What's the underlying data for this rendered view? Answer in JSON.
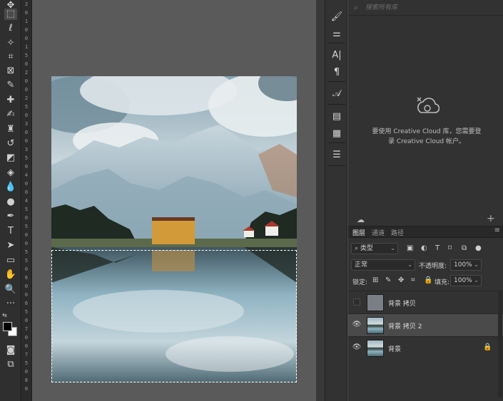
{
  "toolbar": {
    "tools": [
      {
        "name": "move-tool",
        "glyph": "✥"
      },
      {
        "name": "marquee-tool",
        "glyph": "⬚"
      },
      {
        "name": "lasso-tool",
        "glyph": "ℓ"
      },
      {
        "name": "magic-wand-tool",
        "glyph": "✧"
      },
      {
        "name": "crop-tool",
        "glyph": "⌗"
      },
      {
        "name": "frame-tool",
        "glyph": "⊠"
      },
      {
        "name": "eyedropper-tool",
        "glyph": "✎"
      },
      {
        "name": "healing-brush-tool",
        "glyph": "✚"
      },
      {
        "name": "brush-tool",
        "glyph": "✍"
      },
      {
        "name": "stamp-tool",
        "glyph": "♜"
      },
      {
        "name": "history-brush-tool",
        "glyph": "↺"
      },
      {
        "name": "eraser-tool",
        "glyph": "◩"
      },
      {
        "name": "paint-bucket-tool",
        "glyph": "◈"
      },
      {
        "name": "blur-tool",
        "glyph": "💧"
      },
      {
        "name": "dodge-tool",
        "glyph": "●"
      },
      {
        "name": "pen-tool",
        "glyph": "✒"
      },
      {
        "name": "type-tool",
        "glyph": "T"
      },
      {
        "name": "path-selection-tool",
        "glyph": "➤"
      },
      {
        "name": "rectangle-tool",
        "glyph": "▭"
      },
      {
        "name": "hand-tool",
        "glyph": "✋"
      },
      {
        "name": "zoom-tool",
        "glyph": "🔍"
      },
      {
        "name": "more-tools",
        "glyph": "···"
      },
      {
        "name": "quick-mask-tool",
        "glyph": "◙"
      },
      {
        "name": "screen-mode-tool",
        "glyph": "⧉"
      }
    ]
  },
  "ruler": {
    "ticks": [
      "2",
      "0",
      "1",
      "0",
      "0",
      "1",
      "5",
      "0",
      "2",
      "0",
      "0",
      "2",
      "5",
      "0",
      "3",
      "0",
      "0",
      "3",
      "5",
      "0",
      "4",
      "0",
      "0",
      "4",
      "5",
      "0",
      "5",
      "0",
      "0",
      "5",
      "5",
      "0",
      "6",
      "0",
      "0",
      "6",
      "5",
      "0",
      "7",
      "0",
      "0",
      "7",
      "5",
      "0",
      "8",
      "0"
    ]
  },
  "icon_strip": {
    "icons": [
      "brush-settings-icon",
      "adjustments-icon",
      "character-icon",
      "paragraph-icon",
      "glyphs-icon",
      "libraries-icon",
      "notes-icon",
      "properties-icon"
    ],
    "glyphs": [
      "🖌",
      "⚌",
      "A|",
      "¶",
      "𝒜",
      "▤",
      "▦",
      "☰"
    ]
  },
  "libraries": {
    "search_placeholder": "搜索所有库",
    "message_line1": "要使用 Creative Cloud 库，您需要登",
    "message_line2": "录 Creative Cloud 帐户。",
    "add_glyph": "+",
    "sync_glyph": "☁"
  },
  "layers_panel": {
    "tabs": [
      "图层",
      "通道",
      "路径"
    ],
    "active_tab": 0,
    "menu_glyph": "≡",
    "filter_label": "类型",
    "blend_mode": "正常",
    "opacity_label": "不透明度:",
    "opacity_value": "100%",
    "lock_label": "锁定:",
    "fill_label": "填充:",
    "fill_value": "100%",
    "layers": [
      {
        "name": "背景 拷贝",
        "visible": false,
        "active": false,
        "locked": false
      },
      {
        "name": "背景 拷贝 2",
        "visible": true,
        "active": true,
        "locked": false
      },
      {
        "name": "背景",
        "visible": true,
        "active": false,
        "locked": true
      }
    ]
  },
  "colors": {
    "accent": "#4a4a4a",
    "panel_bg": "#323232",
    "canvas_bg": "#5a5a5a"
  }
}
